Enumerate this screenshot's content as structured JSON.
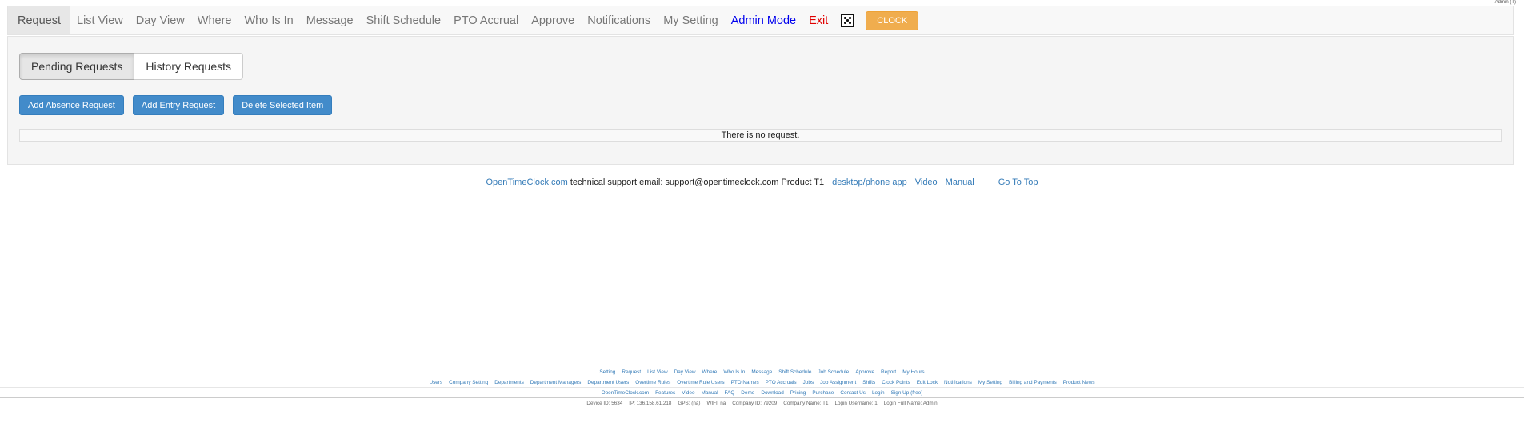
{
  "top_user": "Admin (T)",
  "nav": {
    "items": [
      "Request",
      "List View",
      "Day View",
      "Where",
      "Who Is In",
      "Message",
      "Shift Schedule",
      "PTO Accrual",
      "Approve",
      "Notifications",
      "My Setting"
    ],
    "admin_mode": "Admin Mode",
    "exit": "Exit",
    "clock": "CLOCK",
    "icon": "dice-icon"
  },
  "tabs": {
    "pending": "Pending Requests",
    "history": "History Requests"
  },
  "actions": {
    "add_absence": "Add Absence Request",
    "add_entry": "Add Entry Request",
    "delete_selected": "Delete Selected Item"
  },
  "empty_message": "There is no request.",
  "support": {
    "brand_link": "OpenTimeClock.com",
    "text": " technical support email: support@opentimeclock.com Product T1",
    "desktop_app": "desktop/phone app",
    "video": "Video",
    "manual": "Manual",
    "go_top": "Go To Top"
  },
  "footer": {
    "line1": [
      "Setting",
      "Request",
      "List View",
      "Day View",
      "Where",
      "Who Is In",
      "Message",
      "Shift Schedule",
      "Job Schedule",
      "Approve",
      "Report",
      "My Hours"
    ],
    "line2": [
      "Users",
      "Company Setting",
      "Departments",
      "Department Managers",
      "Department Users",
      "Overtime Rules",
      "Overtime Rule Users",
      "PTO Names",
      "PTO Accruals",
      "Jobs",
      "Job Assignment",
      "Shifts",
      "Clock Points",
      "Edit Lock",
      "Notifications",
      "My Setting",
      "Billing and Payments",
      "Product News"
    ],
    "line3": [
      "OpenTimeClock.com",
      "Features",
      "Video",
      "Manual",
      "FAQ",
      "Demo",
      "Download",
      "Pricing",
      "Purchase",
      "Contact Us",
      "Login",
      "Sign Up (free)"
    ]
  },
  "device": {
    "device_id": "Device ID: 5634",
    "ip": "IP: 136.158.61.218",
    "gps": "GPS: (na)",
    "wifi": "WIFI: na",
    "company_id": "Company ID: 79209",
    "company_name": "Company Name: T1",
    "login_username": "Login Username: 1",
    "login_full_name": "Login Full Name: Admin"
  }
}
